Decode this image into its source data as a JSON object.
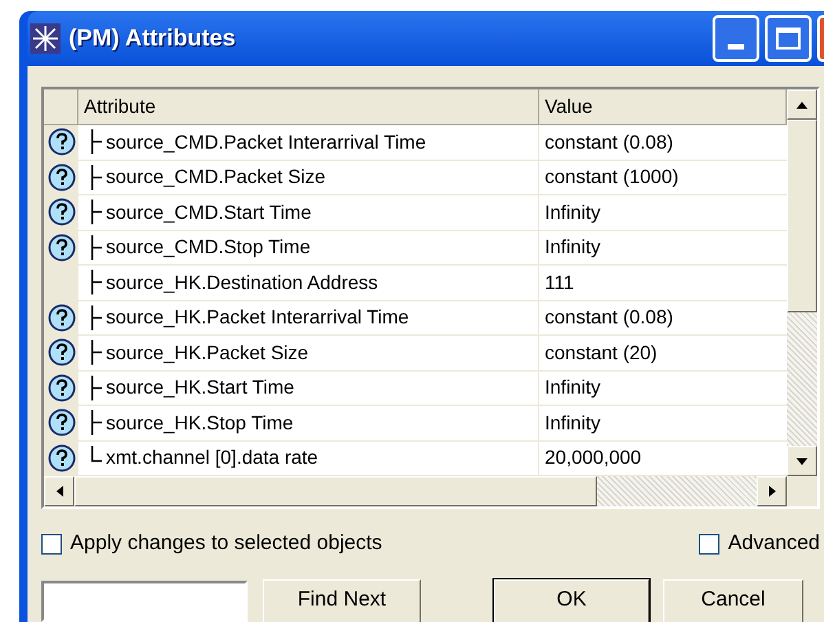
{
  "window": {
    "title": "(PM) Attributes"
  },
  "table": {
    "columns": [
      "Attribute",
      "Value"
    ],
    "rows": [
      {
        "help": true,
        "kind": "tee",
        "attribute": "source_CMD.Packet Interarrival Time",
        "value": "constant (0.08)"
      },
      {
        "help": true,
        "kind": "tee",
        "attribute": "source_CMD.Packet Size",
        "value": "constant (1000)"
      },
      {
        "help": true,
        "kind": "tee",
        "attribute": "source_CMD.Start Time",
        "value": "Infinity"
      },
      {
        "help": true,
        "kind": "tee",
        "attribute": "source_CMD.Stop Time",
        "value": "Infinity"
      },
      {
        "help": false,
        "kind": "tee",
        "attribute": "source_HK.Destination Address",
        "value": "111"
      },
      {
        "help": true,
        "kind": "tee",
        "attribute": "source_HK.Packet Interarrival Time",
        "value": "constant (0.08)"
      },
      {
        "help": true,
        "kind": "tee",
        "attribute": "source_HK.Packet Size",
        "value": "constant (20)"
      },
      {
        "help": true,
        "kind": "tee",
        "attribute": "source_HK.Start Time",
        "value": "Infinity"
      },
      {
        "help": true,
        "kind": "tee",
        "attribute": "source_HK.Stop Time",
        "value": "Infinity"
      },
      {
        "help": true,
        "kind": "end",
        "attribute": "xmt.channel [0].data rate",
        "value": "20,000,000"
      }
    ]
  },
  "options": [
    {
      "label": "Apply changes to selected objects",
      "checked": false
    },
    {
      "label": "Advanced",
      "checked": false
    }
  ],
  "buttons": [
    "Find Next",
    "OK",
    "Cancel"
  ]
}
